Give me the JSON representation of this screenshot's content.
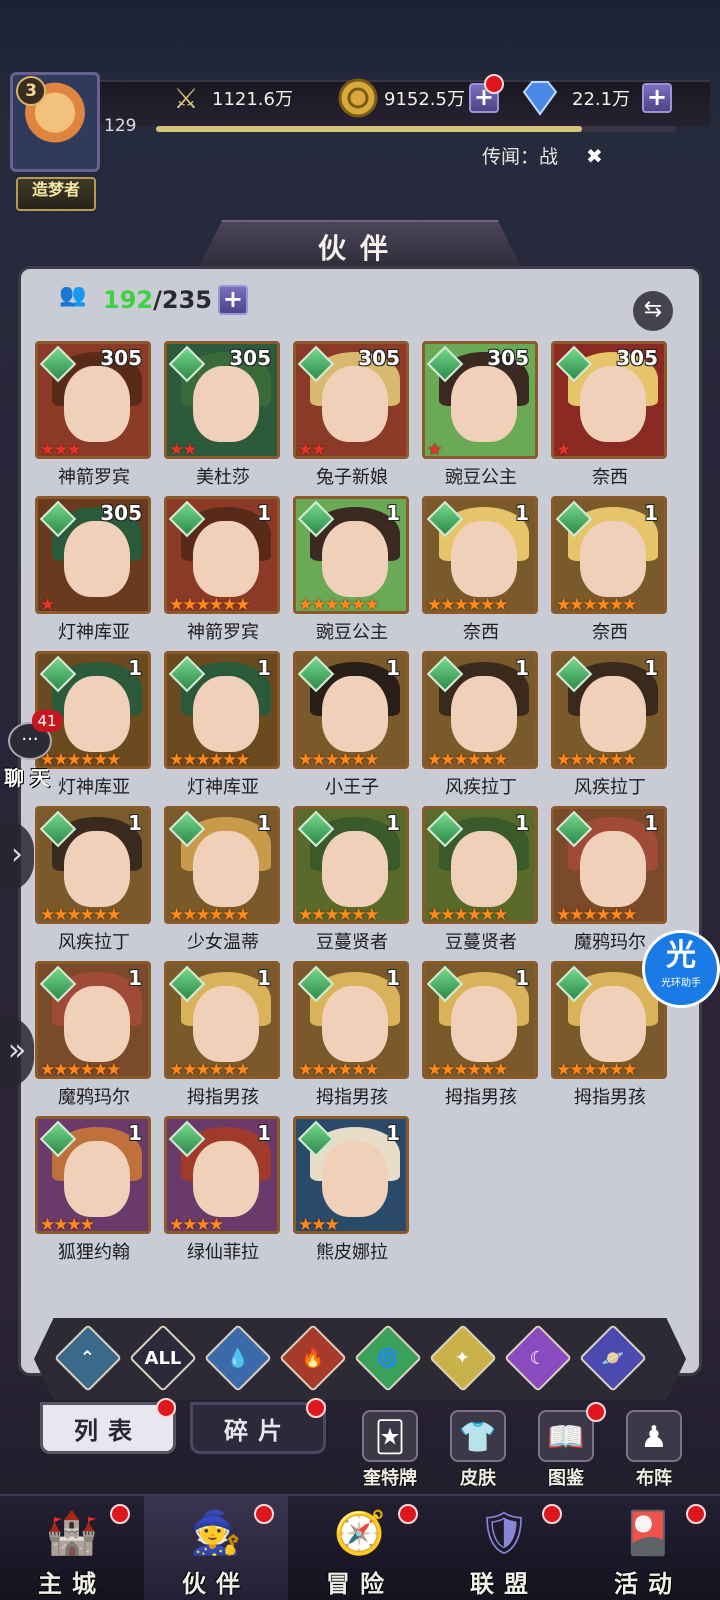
{
  "header": {
    "player_level": "3",
    "title": "造梦者",
    "power": "1121.6万",
    "gold": "9152.5万",
    "diamonds": "22.1万",
    "exp_level": "129",
    "exp_progress": 0.82,
    "rumor": "传闻：战"
  },
  "page_title": "伙伴",
  "roster": {
    "current": "192",
    "max": "/235"
  },
  "heroes": [
    {
      "name": "神箭罗宾",
      "level": "305",
      "stars": 3,
      "star_color": "red",
      "portrait": "#8a3a26",
      "hair": "#5a2a18"
    },
    {
      "name": "美杜莎",
      "level": "305",
      "stars": 2,
      "star_color": "red",
      "portrait": "#2d5a3a",
      "hair": "#3a6a3a"
    },
    {
      "name": "兔子新娘",
      "level": "305",
      "stars": 2,
      "star_color": "red",
      "portrait": "#8a3a26",
      "hair": "#d9b870"
    },
    {
      "name": "豌豆公主",
      "level": "305",
      "stars": 1,
      "star_color": "red",
      "portrait": "#6aaa56",
      "hair": "#3a2a22"
    },
    {
      "name": "奈西",
      "level": "305",
      "stars": 1,
      "star_color": "red",
      "portrait": "#8a2a22",
      "hair": "#e6c46a"
    },
    {
      "name": "灯神库亚",
      "level": "305",
      "stars": 1,
      "star_color": "red",
      "portrait": "#6a3a1e",
      "hair": "#2a5a3a"
    },
    {
      "name": "神箭罗宾",
      "level": "1",
      "stars": 6,
      "star_color": "orange",
      "portrait": "#8a3a26",
      "hair": "#5a2a18"
    },
    {
      "name": "豌豆公主",
      "level": "1",
      "stars": 6,
      "star_color": "orange",
      "portrait": "#6aaa56",
      "hair": "#3a2a22"
    },
    {
      "name": "奈西",
      "level": "1",
      "stars": 6,
      "star_color": "orange",
      "portrait": "#7a5a2a",
      "hair": "#e6c46a"
    },
    {
      "name": "奈西",
      "level": "1",
      "stars": 6,
      "star_color": "orange",
      "portrait": "#7a5a2a",
      "hair": "#e6c46a"
    },
    {
      "name": "灯神库亚",
      "level": "1",
      "stars": 6,
      "star_color": "orange",
      "portrait": "#6a4a1e",
      "hair": "#2a5a3a"
    },
    {
      "name": "灯神库亚",
      "level": "1",
      "stars": 6,
      "star_color": "orange",
      "portrait": "#6a4a1e",
      "hair": "#2a5a3a"
    },
    {
      "name": "小王子",
      "level": "1",
      "stars": 6,
      "star_color": "orange",
      "portrait": "#7a5a2a",
      "hair": "#2a1e18"
    },
    {
      "name": "风疾拉丁",
      "level": "1",
      "stars": 6,
      "star_color": "orange",
      "portrait": "#7a5a2a",
      "hair": "#3a2a1e"
    },
    {
      "name": "风疾拉丁",
      "level": "1",
      "stars": 6,
      "star_color": "orange",
      "portrait": "#7a5a2a",
      "hair": "#3a2a1e"
    },
    {
      "name": "风疾拉丁",
      "level": "1",
      "stars": 6,
      "star_color": "orange",
      "portrait": "#7a5a2a",
      "hair": "#3a2a1e"
    },
    {
      "name": "少女温蒂",
      "level": "1",
      "stars": 6,
      "star_color": "orange",
      "portrait": "#7a5a2a",
      "hair": "#c99a4a"
    },
    {
      "name": "豆蔓贤者",
      "level": "1",
      "stars": 6,
      "star_color": "orange",
      "portrait": "#5a6a2a",
      "hair": "#3a5a2a"
    },
    {
      "name": "豆蔓贤者",
      "level": "1",
      "stars": 6,
      "star_color": "orange",
      "portrait": "#5a6a2a",
      "hair": "#3a5a2a"
    },
    {
      "name": "魔鸦玛尔",
      "level": "1",
      "stars": 6,
      "star_color": "orange",
      "portrait": "#7a4a2a",
      "hair": "#a04a3a"
    },
    {
      "name": "魔鸦玛尔",
      "level": "1",
      "stars": 6,
      "star_color": "orange",
      "portrait": "#7a4a2a",
      "hair": "#a04a3a"
    },
    {
      "name": "拇指男孩",
      "level": "1",
      "stars": 6,
      "star_color": "orange",
      "portrait": "#7a5a2a",
      "hair": "#d9b25a"
    },
    {
      "name": "拇指男孩",
      "level": "1",
      "stars": 6,
      "star_color": "orange",
      "portrait": "#7a5a2a",
      "hair": "#d9b25a"
    },
    {
      "name": "拇指男孩",
      "level": "1",
      "stars": 6,
      "star_color": "orange",
      "portrait": "#7a5a2a",
      "hair": "#d9b25a"
    },
    {
      "name": "拇指男孩",
      "level": "1",
      "stars": 6,
      "star_color": "orange",
      "portrait": "#7a5a2a",
      "hair": "#d9b25a"
    },
    {
      "name": "狐狸约翰",
      "level": "1",
      "stars": 4,
      "star_color": "orange",
      "portrait": "#6a3a6a",
      "hair": "#c0703a"
    },
    {
      "name": "绿仙菲拉",
      "level": "1",
      "stars": 4,
      "star_color": "orange",
      "portrait": "#6a3a6a",
      "hair": "#a03a2a"
    },
    {
      "name": "熊皮娜拉",
      "level": "1",
      "stars": 3,
      "star_color": "orange",
      "portrait": "#2a4a6a",
      "hair": "#e6dcc8"
    }
  ],
  "filters": [
    {
      "id": "guard",
      "label": "",
      "icon": "chevron-up-icon",
      "color": "#3a6a8a"
    },
    {
      "id": "all",
      "label": "ALL",
      "icon": "all-icon",
      "color": "#2a2a3a"
    },
    {
      "id": "water",
      "label": "💧",
      "icon": "water-icon",
      "color": "#3a6aaa"
    },
    {
      "id": "fire",
      "label": "🔥",
      "icon": "fire-icon",
      "color": "#a83a2a"
    },
    {
      "id": "wind",
      "label": "🌀",
      "icon": "wind-icon",
      "color": "#3aa05a"
    },
    {
      "id": "light",
      "label": "✦",
      "icon": "light-icon",
      "color": "#c9b24a"
    },
    {
      "id": "dark",
      "label": "☾",
      "icon": "moon-icon",
      "color": "#8a4ac0"
    },
    {
      "id": "planet",
      "label": "🪐",
      "icon": "planet-icon",
      "color": "#4a4ab0"
    }
  ],
  "subtabs": {
    "list": "列表",
    "shards": "碎片"
  },
  "side_buttons": [
    {
      "label": "奎特牌",
      "icon": "🃏"
    },
    {
      "label": "皮肤",
      "icon": "👕"
    },
    {
      "label": "图鉴",
      "icon": "📖"
    },
    {
      "label": "布阵",
      "icon": "♟"
    }
  ],
  "chat": {
    "count": "41",
    "label": "聊天"
  },
  "assistant": {
    "big": "光",
    "small": "光环助手"
  },
  "nav": [
    {
      "label": "主城",
      "icon": "🏰"
    },
    {
      "label": "伙伴",
      "icon": "🧙"
    },
    {
      "label": "冒险",
      "icon": "🧭"
    },
    {
      "label": "联盟",
      "icon": "🛡"
    },
    {
      "label": "活动",
      "icon": "🎴"
    }
  ]
}
